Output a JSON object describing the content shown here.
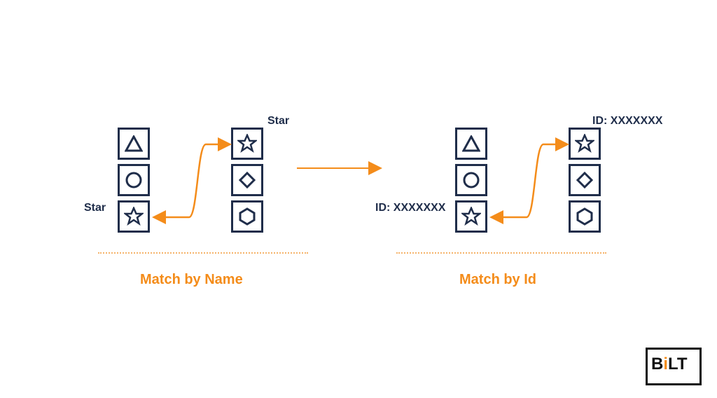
{
  "left": {
    "label_top": "Star",
    "label_side": "Star",
    "caption": "Match by Name"
  },
  "right": {
    "label_top": "ID: XXXXXXX",
    "label_side": "ID: XXXXXXX",
    "caption": "Match by Id"
  },
  "colors": {
    "outline": "#1f2d4a",
    "accent": "#f48c1a"
  },
  "logo": {
    "text_main": "B",
    "text_accent": "i",
    "text_rest": "LT",
    "sub": ""
  }
}
